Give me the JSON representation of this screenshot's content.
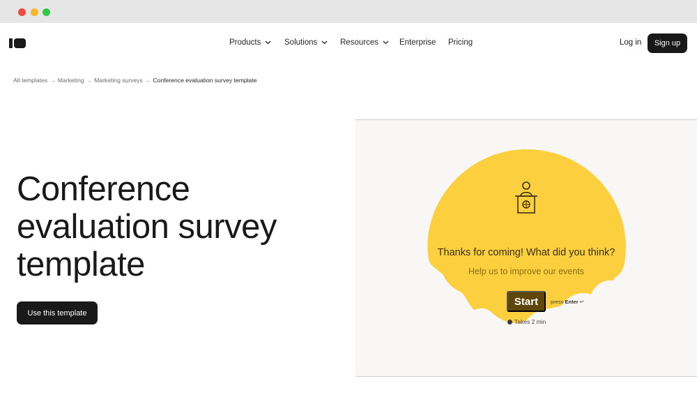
{
  "nav": {
    "items": [
      {
        "label": "Products",
        "has_dropdown": true
      },
      {
        "label": "Solutions",
        "has_dropdown": true
      },
      {
        "label": "Resources",
        "has_dropdown": true
      },
      {
        "label": "Enterprise",
        "has_dropdown": false
      },
      {
        "label": "Pricing",
        "has_dropdown": false
      }
    ],
    "login_label": "Log in",
    "signup_label": "Sign up"
  },
  "breadcrumb": {
    "items": [
      "All templates",
      "Marketing",
      "Marketing surveys"
    ],
    "current": "Conference evaluation survey template",
    "separator": "→"
  },
  "hero": {
    "title_lines": [
      "Conference",
      "evaluation survey",
      "template"
    ],
    "cta_label": "Use this template"
  },
  "preview": {
    "icon": "podium-speaker-icon",
    "question": "Thanks for coming! What did you think?",
    "subtitle": "Help us to improve our events",
    "start_label": "Start",
    "press_prefix": "press",
    "press_key": "Enter",
    "press_symbol": "↵",
    "duration": "Takes 2 min"
  },
  "colors": {
    "accent_yellow": "#fbcf3d",
    "start_button": "#5e4708",
    "dark": "#191919"
  }
}
